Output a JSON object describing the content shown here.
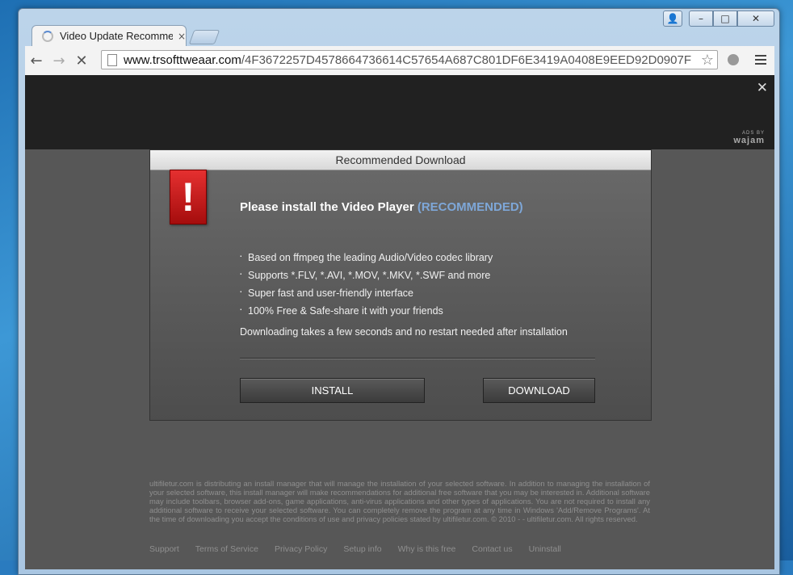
{
  "browser": {
    "tab_title": "Video Update Recommen",
    "tab_close": "×",
    "url_domain": "www.trsofttweaar.com",
    "url_path": "/4F3672257D4578664736614C57654A687C801DF6E3419A0408E9EED92D0907F",
    "back_icon": "←",
    "forward_icon": "→",
    "stop_icon": "✕",
    "star_icon": "☆"
  },
  "window_controls": {
    "user": "👤",
    "minimize": "–",
    "maximize": "□",
    "close": "✕"
  },
  "ad_bar": {
    "close": "✕",
    "ads_by": "ADS BY",
    "brand": "wajam"
  },
  "dialog": {
    "title": "Recommended Download",
    "warning_glyph": "!",
    "headline": "Please install the Video Player ",
    "headline_highlight": "(RECOMMENDED)",
    "features": [
      "Based on ffmpeg the leading Audio/Video codec library",
      "Supports *.FLV, *.AVI, *.MOV, *.MKV, *.SWF and more",
      "Super fast and user-friendly interface",
      "100% Free & Safe-share it with your friends"
    ],
    "note": "Downloading takes a few seconds and no restart needed after installation",
    "install_label": "INSTALL",
    "download_label": "DOWNLOAD"
  },
  "legal_text": "ultifiletur.com is distributing an install manager that will manage the installation of your selected software. In addition to managing the installation of your selected software, this install manager will make recommendations for additional free software that you may be interested in. Additional software may include toolbars, browser add-ons, game applications, anti-virus applications and other types of applications. You are not required to install any additional software to receive your selected software. You can completely remove the program at any time in Windows 'Add/Remove Programs'. At the time of downloading you accept the conditions of use and privacy policies stated by ultifiletur.com. © 2010 - - ultifiletur.com. All rights reserved.",
  "footer_links": [
    "Support",
    "Terms of Service",
    "Privacy Policy",
    "Setup info",
    "Why is this free",
    "Contact us",
    "Uninstall"
  ]
}
